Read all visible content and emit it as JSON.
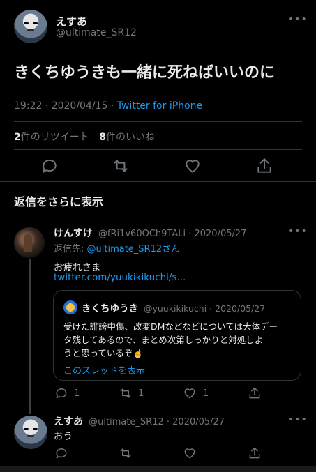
{
  "main_tweet": {
    "display_name": "えすあ",
    "handle": "@ultimate_SR12",
    "text": "きくちゆうきも一緒に死ねばいいのに",
    "time": "19:22 · 2020/04/15 · ",
    "client": "Twitter for iPhone",
    "retweets_count": "2",
    "retweets_label": "件のリツイート",
    "likes_count": "8",
    "likes_label": "件のいいね",
    "more": "•••"
  },
  "replies_header": "返信をさらに表示",
  "reply": {
    "display_name": "けんすけ",
    "handle_date": "@fRi1v60OCh9TALi · 2020/05/27",
    "replying_prefix": "返信先: ",
    "replying_to": "@ultimate_SR12さん",
    "text": "お疲れさま",
    "link": "twitter.com/yuukikikuchi/s...",
    "more": "•••",
    "quote": {
      "display_name": "きくちゆうき",
      "handle_date": "@yuukikikuchi · 2020/05/27",
      "text_line1": "受けた誹謗中傷、改変DMなどなどについては大体デー",
      "text_line2": "タ残してあるので、まとめ次第しっかりと対処しよ",
      "text_line3": "うと思っているぞ☝️",
      "thread_link": "このスレッドを表示"
    },
    "reply_count": "1",
    "retweet_count": "1",
    "like_count": "1"
  },
  "reply2": {
    "display_name": "えすあ",
    "handle_date": "@ultimate_SR12 · 2020/05/27",
    "text": "おう",
    "more": "•••"
  }
}
